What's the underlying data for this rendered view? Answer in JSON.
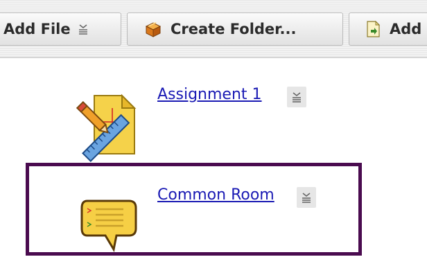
{
  "toolbar": {
    "add_file_label": "Add File",
    "create_folder_label": "Create Folder...",
    "add_more_label": "Add"
  },
  "items": [
    {
      "title": "Assignment 1",
      "icon": "assignment-icon"
    },
    {
      "title": "Common Room",
      "icon": "forum-icon",
      "highlighted": true
    }
  ],
  "colors": {
    "link": "#1a1ab4",
    "highlight_border": "#4a0b4f",
    "toolbar_bg": "#ebebeb"
  }
}
